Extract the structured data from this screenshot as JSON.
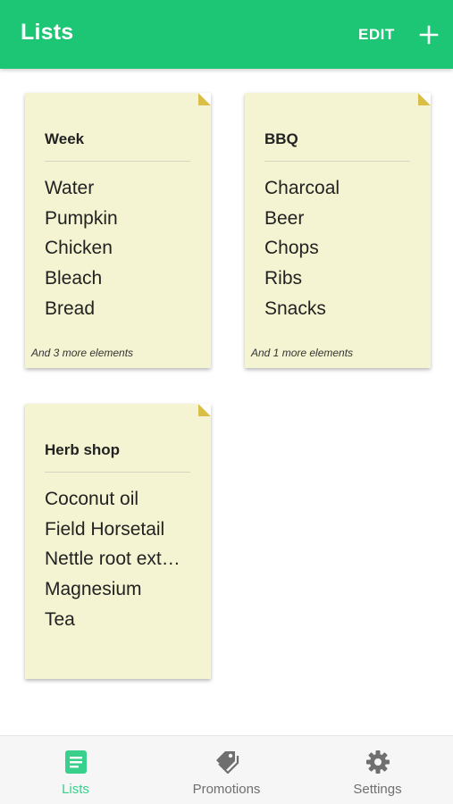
{
  "appbar": {
    "title": "Lists",
    "edit_label": "EDIT",
    "add_icon": "plus-icon",
    "color": "#1cc675"
  },
  "cards": [
    {
      "title": "Week",
      "items": [
        "Water",
        "Pumpkin",
        "Chicken",
        "Bleach",
        "Bread"
      ],
      "more": "And 3 more elements"
    },
    {
      "title": "BBQ",
      "items": [
        "Charcoal",
        "Beer",
        "Chops",
        "Ribs",
        "Snacks"
      ],
      "more": "And 1 more elements"
    },
    {
      "title": "Herb shop",
      "items": [
        "Coconut oil",
        "Field Horsetail",
        "Nettle root ext…",
        "Magnesium",
        "Tea"
      ],
      "more": ""
    }
  ],
  "colors": {
    "card_background": "#f4f4d2",
    "card_fold": "#d9bf48",
    "active_tab": "#39d08b",
    "inactive_tab": "#6f6f6f"
  },
  "bottom_nav": [
    {
      "label": "Lists",
      "icon": "list-icon",
      "active": true
    },
    {
      "label": "Promotions",
      "icon": "tag-icon",
      "active": false
    },
    {
      "label": "Settings",
      "icon": "gear-icon",
      "active": false
    }
  ]
}
